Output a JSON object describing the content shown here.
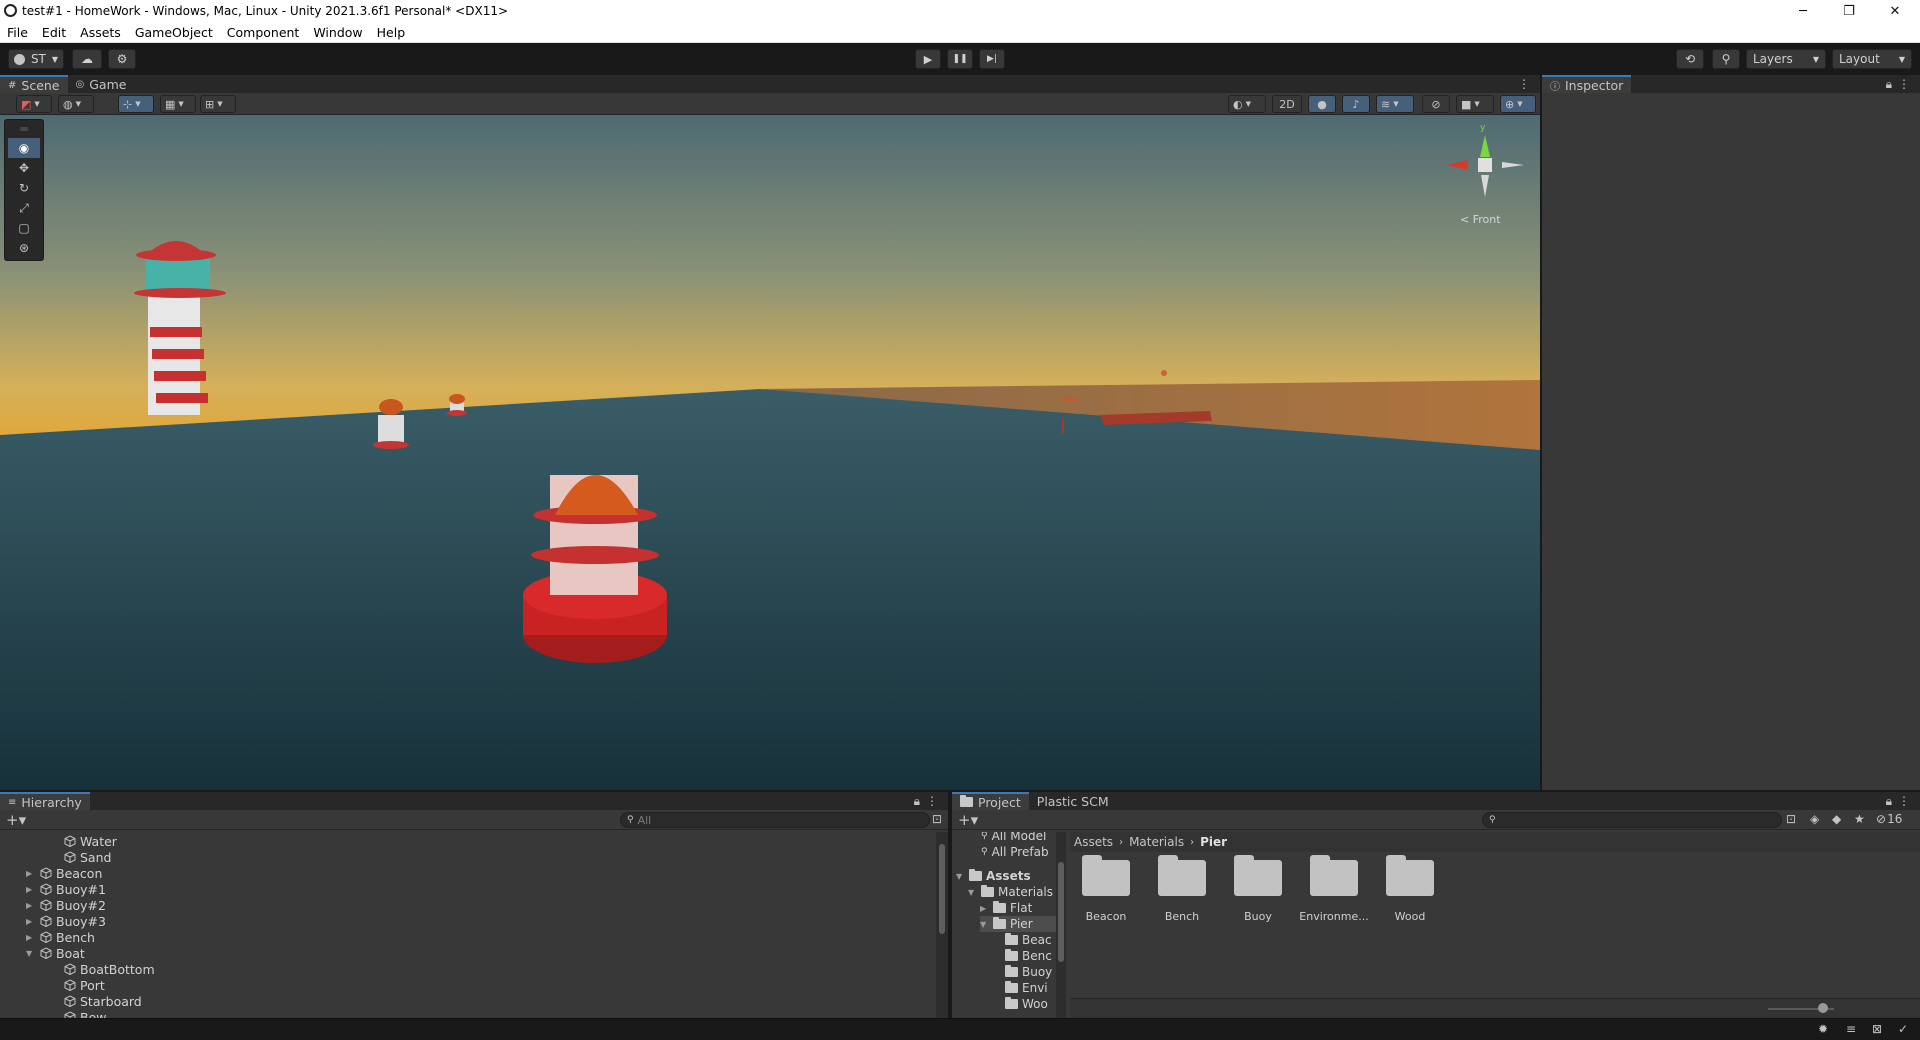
{
  "window": {
    "title": "test#1 - HomeWork - Windows, Mac, Linux - Unity 2021.3.6f1 Personal* <DX11>",
    "controls": [
      "─",
      "❐",
      "✕"
    ]
  },
  "menu": [
    "File",
    "Edit",
    "Assets",
    "GameObject",
    "Component",
    "Window",
    "Help"
  ],
  "toolbar": {
    "account_label": "ST",
    "play_icon": "▶",
    "pause_icon": "❚❚",
    "step_icon": "▶|",
    "layers_label": "Layers",
    "layout_label": "Layout"
  },
  "scene_panel": {
    "tabs": [
      "Scene",
      "Game"
    ],
    "toggle_2d": "2D",
    "gizmo_label": "< Front",
    "gizmo_axes": {
      "y": "y"
    }
  },
  "inspector": {
    "tab": "Inspector"
  },
  "hierarchy": {
    "tab": "Hierarchy",
    "search_placeholder": "All",
    "items": [
      {
        "label": "Water",
        "depth": 2,
        "expander": ""
      },
      {
        "label": "Sand",
        "depth": 2,
        "expander": ""
      },
      {
        "label": "Beacon",
        "depth": 1,
        "expander": "▶"
      },
      {
        "label": "Buoy#1",
        "depth": 1,
        "expander": "▶"
      },
      {
        "label": "Buoy#2",
        "depth": 1,
        "expander": "▶"
      },
      {
        "label": "Buoy#3",
        "depth": 1,
        "expander": "▶"
      },
      {
        "label": "Bench",
        "depth": 1,
        "expander": "▶"
      },
      {
        "label": "Boat",
        "depth": 1,
        "expander": "▼"
      },
      {
        "label": "BoatBottom",
        "depth": 2,
        "expander": ""
      },
      {
        "label": "Port",
        "depth": 2,
        "expander": ""
      },
      {
        "label": "Starboard",
        "depth": 2,
        "expander": ""
      },
      {
        "label": "Bow",
        "depth": 2,
        "expander": ""
      }
    ]
  },
  "project": {
    "tabs": [
      "Project",
      "Plastic SCM"
    ],
    "hidden_count": "16",
    "breadcrumb": [
      "Assets",
      "Materials",
      "Pier"
    ],
    "tree": [
      {
        "label": "All Model",
        "depth": 1,
        "expander": "",
        "type": "search"
      },
      {
        "label": "All Prefab",
        "depth": 1,
        "expander": "",
        "type": "search"
      },
      {
        "label": "Assets",
        "depth": 0,
        "expander": "▼",
        "type": "folder",
        "bold": true
      },
      {
        "label": "Materials",
        "depth": 1,
        "expander": "▼",
        "type": "folder"
      },
      {
        "label": "Flat",
        "depth": 2,
        "expander": "▶",
        "type": "folder"
      },
      {
        "label": "Pier",
        "depth": 2,
        "expander": "▼",
        "type": "folder",
        "selected": true
      },
      {
        "label": "Beac",
        "depth": 3,
        "expander": "",
        "type": "folder"
      },
      {
        "label": "Benc",
        "depth": 3,
        "expander": "",
        "type": "folder"
      },
      {
        "label": "Buoy",
        "depth": 3,
        "expander": "",
        "type": "folder"
      },
      {
        "label": "Envi",
        "depth": 3,
        "expander": "",
        "type": "folder"
      },
      {
        "label": "Woo",
        "depth": 3,
        "expander": "",
        "type": "folder"
      }
    ],
    "assets": [
      "Beacon",
      "Bench",
      "Buoy",
      "Environme...",
      "Wood"
    ]
  }
}
